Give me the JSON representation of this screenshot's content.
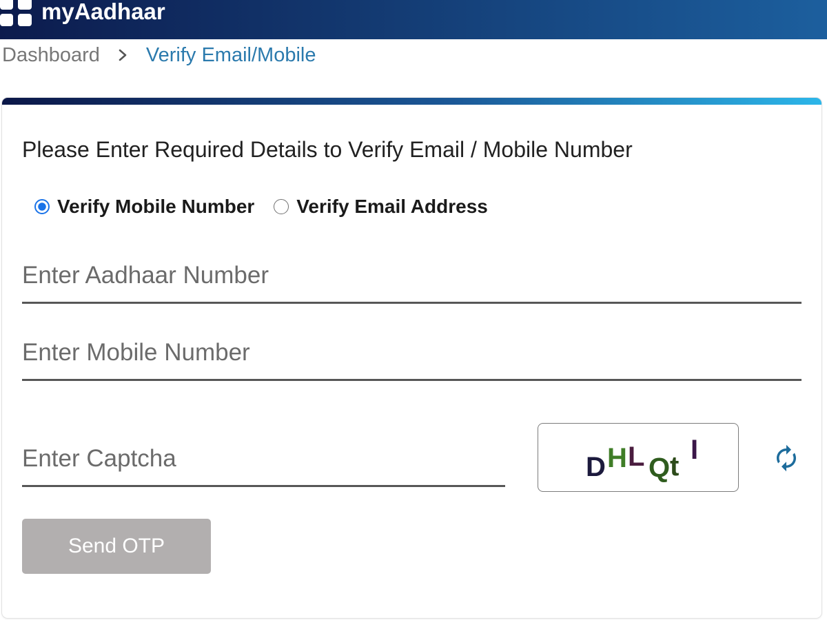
{
  "theme": {
    "header_start": "#0c1b4d",
    "header_end": "#1c5f9e",
    "accent_start": "#0b1748",
    "accent_mid": "#1b5897",
    "accent_end": "#2cb6e9",
    "breadcrumb_current": "#2b7aad",
    "radio_accent": "#1a73e8",
    "button_disabled_bg": "#b2afaf",
    "refresh_icon": "#1d6c9c"
  },
  "header": {
    "logo_icon": "app-grid-icon",
    "title": "myAadhaar"
  },
  "breadcrumb": {
    "items": [
      {
        "label": "Dashboard"
      },
      {
        "label": "Verify Email/Mobile"
      }
    ],
    "separator_icon": "chevron-right-icon"
  },
  "form": {
    "heading": "Please Enter Required Details to Verify Email / Mobile Number",
    "verify_options": [
      {
        "label": "Verify Mobile Number",
        "selected": true
      },
      {
        "label": "Verify Email Address",
        "selected": false
      }
    ],
    "fields": {
      "aadhaar": {
        "placeholder": "Enter Aadhaar Number",
        "value": ""
      },
      "mobile": {
        "placeholder": "Enter Mobile Number",
        "value": ""
      },
      "captcha": {
        "placeholder": "Enter Captcha",
        "value": ""
      }
    },
    "captcha_image": {
      "characters": [
        {
          "char": "D",
          "color": "#1c1a3d"
        },
        {
          "char": "H",
          "color": "#3f7d27"
        },
        {
          "char": "L",
          "color": "#4a1d3f"
        },
        {
          "char": "Q",
          "color": "#2f5c1e"
        },
        {
          "char": "t",
          "color": "#2d4b1a"
        },
        {
          "char": "I",
          "color": "#3b1748"
        }
      ]
    },
    "refresh_icon": "refresh-icon",
    "send_otp_label": "Send OTP"
  }
}
